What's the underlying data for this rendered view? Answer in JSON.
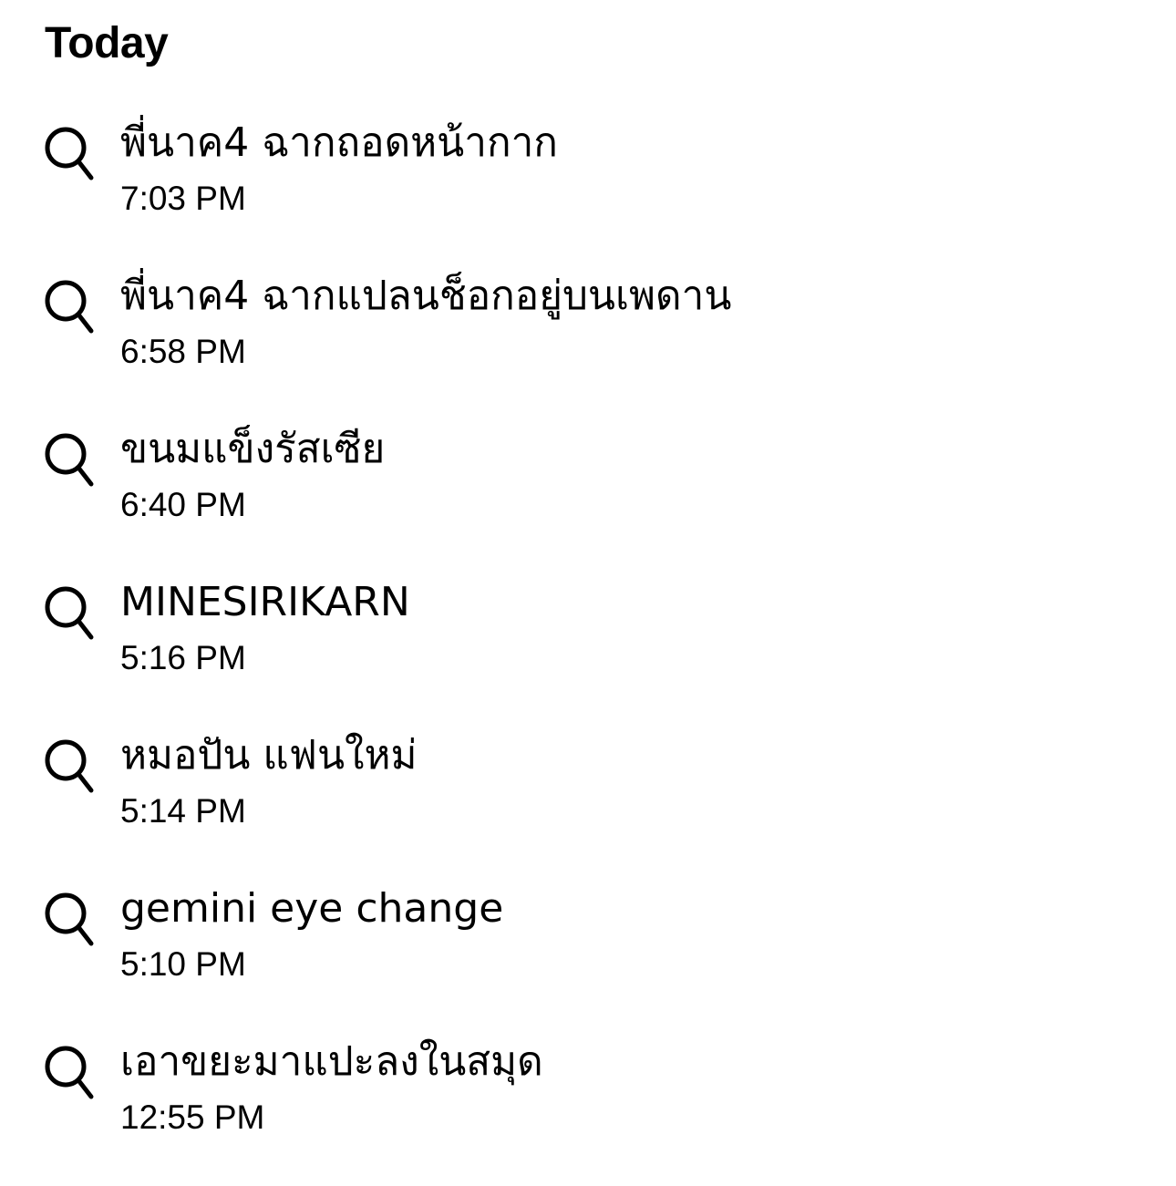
{
  "section": {
    "title": "Today"
  },
  "entries": [
    {
      "icon": "search-icon",
      "query": "พี่นาค4 ฉากถอดหน้ากาก",
      "time": "7:03 PM"
    },
    {
      "icon": "search-icon",
      "query": "พี่นาค4 ฉากแปลนช็อกอยู่บนเพดาน",
      "time": "6:58 PM"
    },
    {
      "icon": "search-icon",
      "query": "ขนมแข็งรัสเซีย",
      "time": "6:40 PM"
    },
    {
      "icon": "search-icon",
      "query": "MINESIRIKARN",
      "time": "5:16 PM"
    },
    {
      "icon": "search-icon",
      "query": "หมอปัน แฟนใหม่",
      "time": "5:14 PM"
    },
    {
      "icon": "search-icon",
      "query": "gemini eye change",
      "time": "5:10 PM"
    },
    {
      "icon": "search-icon",
      "query": "เอาขยะมาแปะลงในสมุด",
      "time": "12:55 PM"
    }
  ]
}
